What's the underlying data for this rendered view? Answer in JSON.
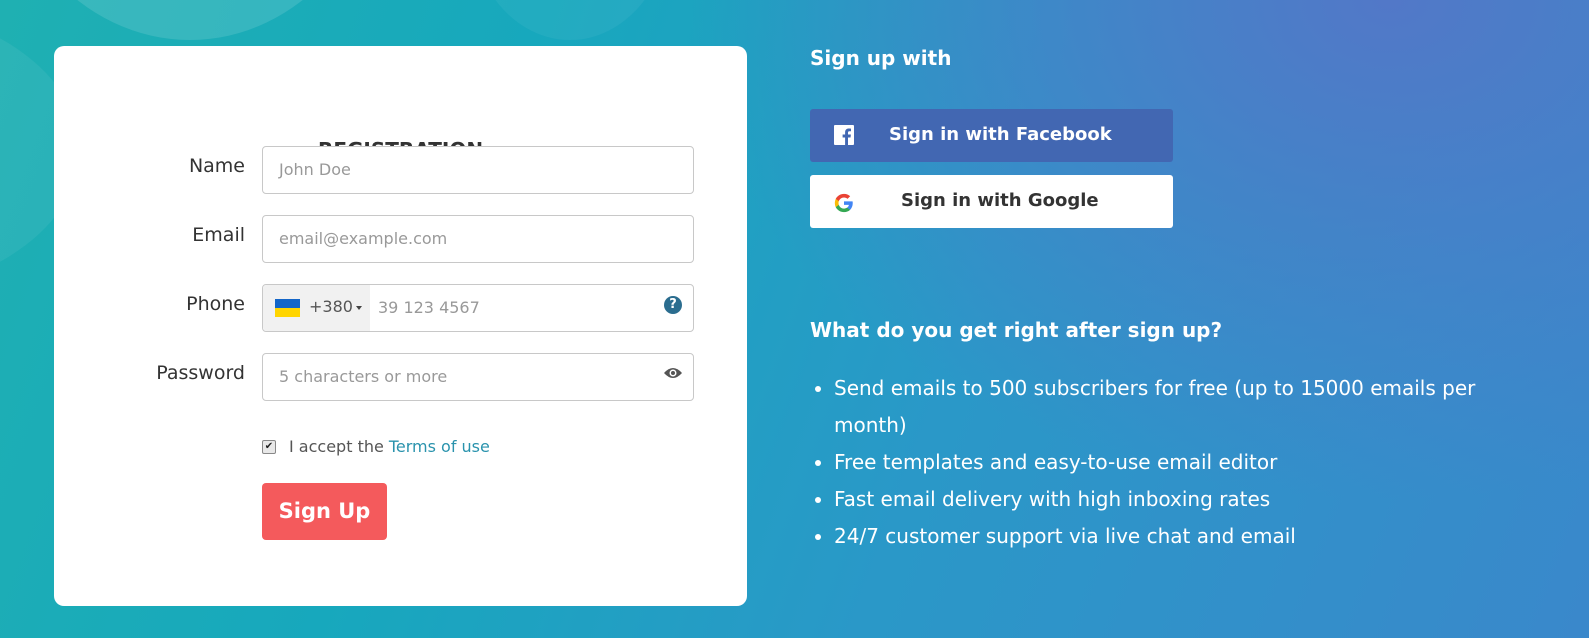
{
  "form": {
    "title": "REGISTRATION",
    "name": {
      "label": "Name",
      "placeholder": "John Doe"
    },
    "email": {
      "label": "Email",
      "placeholder": "email@example.com"
    },
    "phone": {
      "label": "Phone",
      "country_code": "+380",
      "country_flag": "ukraine-flag",
      "placeholder": "39 123 4567",
      "help_icon": "question-circle-icon"
    },
    "password": {
      "label": "Password",
      "placeholder": "5 characters or more",
      "toggle_icon": "eye-icon"
    },
    "terms": {
      "checked": true,
      "prefix": "I accept the",
      "link": "Terms of use"
    },
    "submit_label": "Sign Up",
    "submit_color": "#f45a5c"
  },
  "social": {
    "heading": "Sign up with",
    "facebook": {
      "label": "Sign in with Facebook",
      "icon": "facebook-icon",
      "color": "#4267b2"
    },
    "google": {
      "label": "Sign in with Google",
      "icon": "google-icon"
    }
  },
  "benefits": {
    "heading": "What do you get right after sign up?",
    "items": [
      "Send emails to 500 subscribers for free (up to 15000 emails per month)",
      "Free templates and easy-to-use email editor",
      "Fast email delivery with high inboxing rates",
      "24/7 customer support via live chat and email"
    ]
  }
}
